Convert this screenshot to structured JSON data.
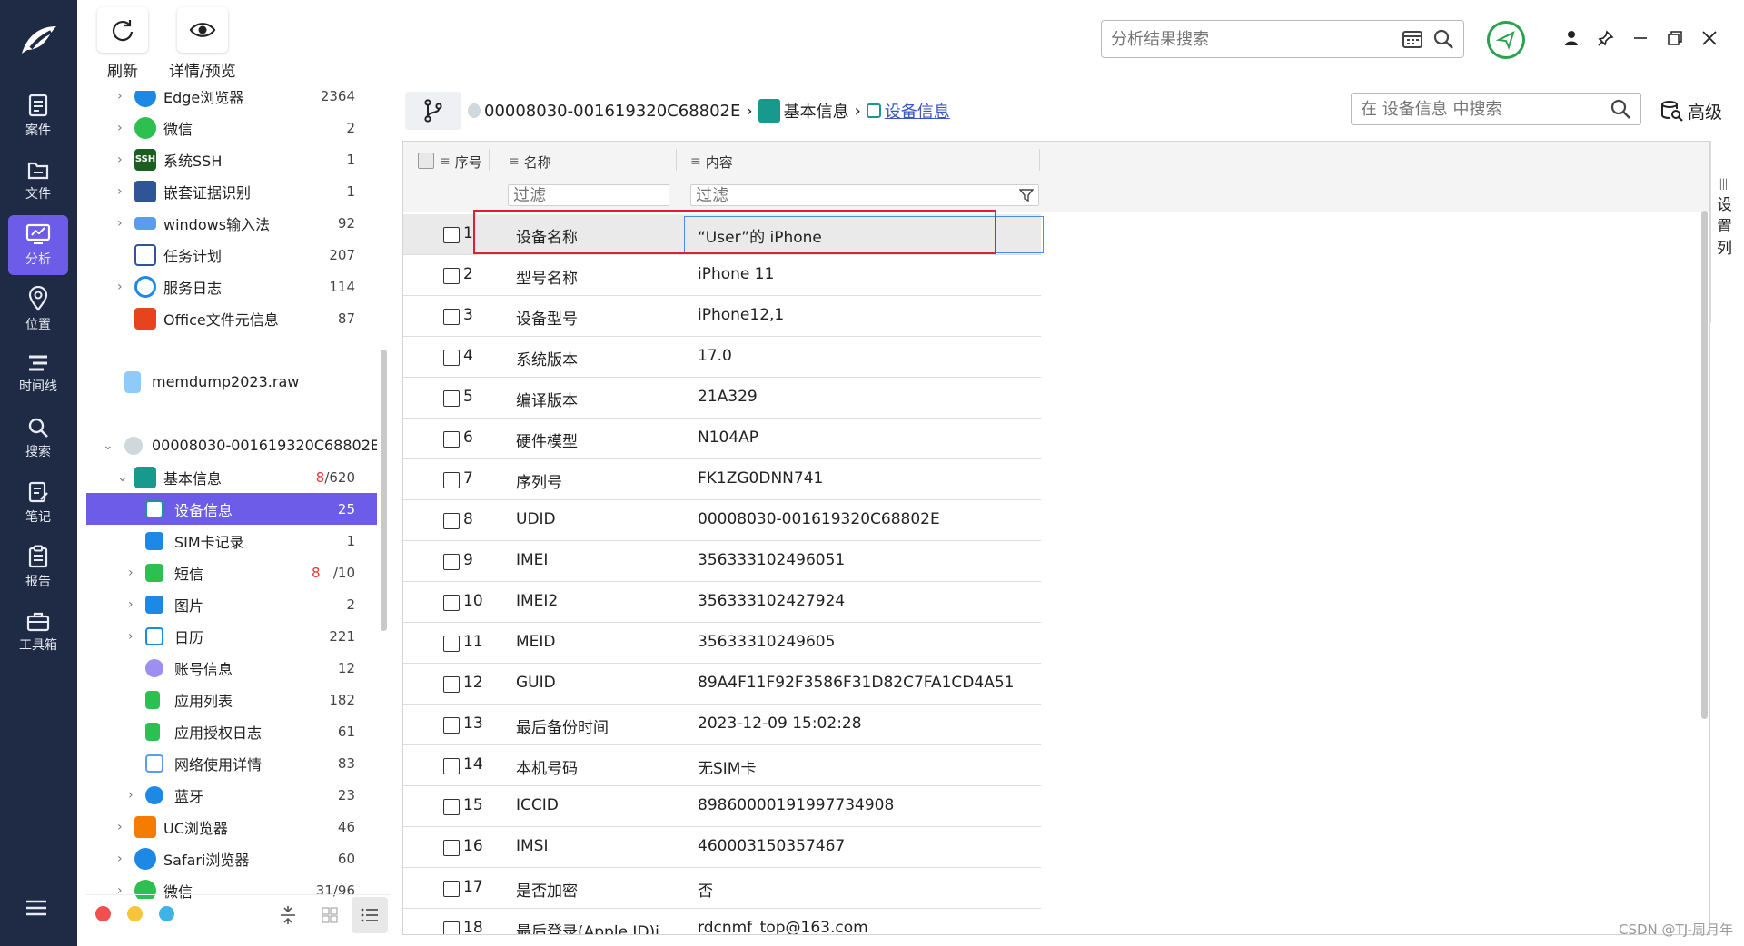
{
  "toolbar": {
    "refresh_label": "刷新",
    "detail_label": "详情/预览"
  },
  "top_search": {
    "placeholder": "分析结果搜索"
  },
  "nav": [
    {
      "label": "案件",
      "icon": "case-icon"
    },
    {
      "label": "文件",
      "icon": "folder-icon"
    },
    {
      "label": "分析",
      "icon": "analysis-icon",
      "active": true
    },
    {
      "label": "位置",
      "icon": "location-icon"
    },
    {
      "label": "时间线",
      "icon": "timeline-icon"
    },
    {
      "label": "搜索",
      "icon": "search-icon"
    },
    {
      "label": "笔记",
      "icon": "note-icon"
    },
    {
      "label": "报告",
      "icon": "report-icon"
    },
    {
      "label": "工具箱",
      "icon": "toolbox-icon"
    }
  ],
  "tree": {
    "items": [
      {
        "label": "Edge浏览器",
        "count": "2364"
      },
      {
        "label": "微信",
        "count": "2"
      },
      {
        "label": "系统SSH",
        "count": "1"
      },
      {
        "label": "嵌套证据识别",
        "count": "1"
      },
      {
        "label": "windows输入法",
        "count": "92"
      },
      {
        "label": "任务计划",
        "count": "207"
      },
      {
        "label": "服务日志",
        "count": "114"
      },
      {
        "label": "Office文件元信息",
        "count": "87"
      },
      {
        "label": "memdump2023.raw",
        "count": ""
      },
      {
        "label": "00008030-001619320C68802E",
        "count": ""
      },
      {
        "label": "基本信息",
        "count_red": "8",
        "count": "/620"
      },
      {
        "label": "设备信息",
        "count": "25"
      },
      {
        "label": "SIM卡记录",
        "count": "1"
      },
      {
        "label": "短信",
        "count_red": "8",
        "count": "/10"
      },
      {
        "label": "图片",
        "count": "2"
      },
      {
        "label": "日历",
        "count": "221"
      },
      {
        "label": "账号信息",
        "count": "12"
      },
      {
        "label": "应用列表",
        "count": "182"
      },
      {
        "label": "应用授权日志",
        "count": "61"
      },
      {
        "label": "网络使用详情",
        "count": "83"
      },
      {
        "label": "蓝牙",
        "count": "23"
      },
      {
        "label": "UC浏览器",
        "count": "46"
      },
      {
        "label": "Safari浏览器",
        "count": "60"
      },
      {
        "label": "微信",
        "count": "31/96"
      }
    ]
  },
  "breadcrumb": {
    "device": "00008030-001619320C68802E",
    "section": "基本信息",
    "current": "设备信息"
  },
  "inner_search": {
    "placeholder": "在 设备信息 中搜索"
  },
  "advanced_label": "高级",
  "grid": {
    "columns": {
      "index": "序号",
      "name": "名称",
      "content": "内容"
    },
    "filter_placeholder": "过滤",
    "rows": [
      {
        "n": "1",
        "name": "设备名称",
        "value": "“User”的 iPhone"
      },
      {
        "n": "2",
        "name": "型号名称",
        "value": "iPhone 11"
      },
      {
        "n": "3",
        "name": "设备型号",
        "value": "iPhone12,1"
      },
      {
        "n": "4",
        "name": "系统版本",
        "value": "17.0"
      },
      {
        "n": "5",
        "name": "编译版本",
        "value": "21A329"
      },
      {
        "n": "6",
        "name": "硬件模型",
        "value": "N104AP"
      },
      {
        "n": "7",
        "name": "序列号",
        "value": "FK1ZG0DNN741"
      },
      {
        "n": "8",
        "name": "UDID",
        "value": "00008030-001619320C68802E"
      },
      {
        "n": "9",
        "name": "IMEI",
        "value": "356333102496051"
      },
      {
        "n": "10",
        "name": "IMEI2",
        "value": "356333102427924"
      },
      {
        "n": "11",
        "name": "MEID",
        "value": "35633310249605"
      },
      {
        "n": "12",
        "name": "GUID",
        "value": "89A4F11F92F3586F31D82C7FA1CD4A51"
      },
      {
        "n": "13",
        "name": "最后备份时间",
        "value": "2023-12-09 15:02:28"
      },
      {
        "n": "14",
        "name": "本机号码",
        "value": "无SIM卡"
      },
      {
        "n": "15",
        "name": "ICCID",
        "value": "89860000191997734908"
      },
      {
        "n": "16",
        "name": "IMSI",
        "value": "460003150357467"
      },
      {
        "n": "17",
        "name": "是否加密",
        "value": "否"
      },
      {
        "n": "18",
        "name": "最后登录(Apple ID)i",
        "value": "rdcnmf_top@163.com"
      }
    ]
  },
  "column_settings_label": [
    "设",
    "置",
    "列"
  ],
  "watermark": "CSDN @TJ-周月年",
  "colors": {
    "nav_bg": "#1f2a44",
    "accent": "#6c5ce7",
    "highlight_box": "#e0202c",
    "share_green": "#2ca14f"
  }
}
